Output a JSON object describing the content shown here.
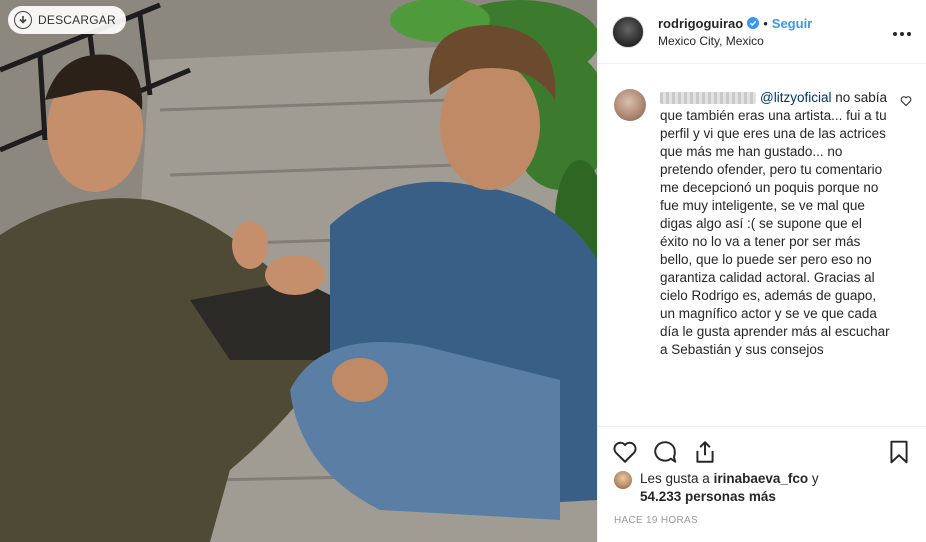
{
  "download": {
    "label": "DESCARGAR"
  },
  "header": {
    "username": "rodrigoguirao",
    "separator": "•",
    "follow_label": "Seguir",
    "location": "Mexico City, Mexico"
  },
  "comment": {
    "mention": "@litzyoficial",
    "text": " no sabía que también eras una artista... fui a tu perfil y vi que eres una de las actrices que más me han gustado... no pretendo ofender, pero tu comentario me decepcionó un poquis porque no fue muy inteligente, se ve mal que digas algo así :( se supone que el éxito no lo va a tener por ser más bello, que lo puede ser pero eso no garantiza calidad actoral. Gracias al cielo Rodrigo es, además de guapo, un magnífico actor y se ve que cada día le gusta aprender más al escuchar a Sebastián y sus consejos"
  },
  "likes": {
    "prefix": "Les gusta a ",
    "first_user": "irinabaeva_fco",
    "joiner": " y ",
    "count_text": "54.233 personas más"
  },
  "timestamp": "HACE 19 HORAS",
  "colors": {
    "link": "#3897f0",
    "mention": "#003569",
    "verified": "#3897f0"
  }
}
